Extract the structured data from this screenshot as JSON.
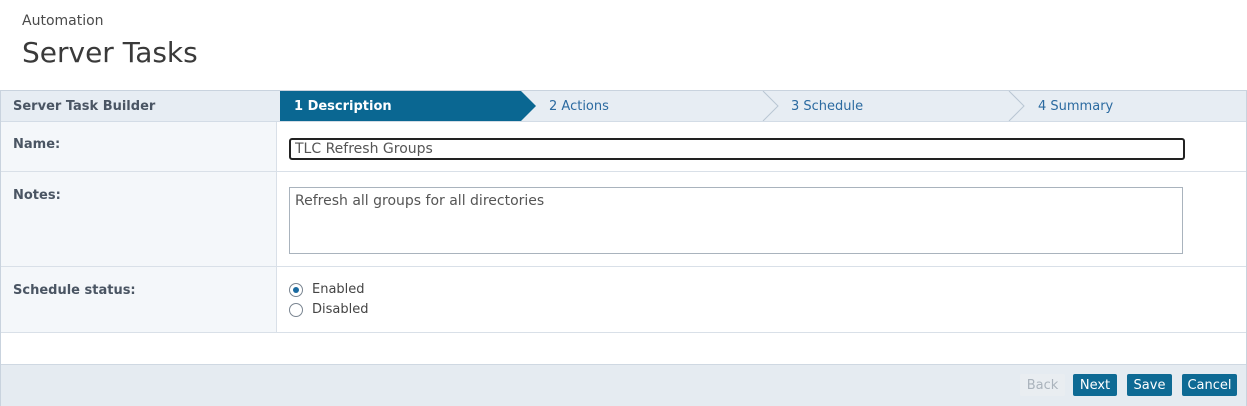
{
  "header": {
    "breadcrumb": "Automation",
    "title": "Server Tasks"
  },
  "builder": {
    "title": "Server Task Builder",
    "steps": [
      {
        "label": "1 Description",
        "active": true
      },
      {
        "label": "2 Actions",
        "active": false
      },
      {
        "label": "3 Schedule",
        "active": false
      },
      {
        "label": "4 Summary",
        "active": false
      }
    ]
  },
  "form": {
    "name_label": "Name:",
    "name_value": "TLC Refresh Groups",
    "notes_label": "Notes:",
    "notes_value": "Refresh all groups for all directories",
    "schedule_label": "Schedule status:",
    "options": [
      "Enabled",
      "Disabled"
    ],
    "selected": "Enabled"
  },
  "footer": {
    "back": "Back",
    "next": "Next",
    "save": "Save",
    "cancel": "Cancel"
  },
  "colors": {
    "accent": "#0e6a94",
    "active_step": "#0a6792"
  }
}
